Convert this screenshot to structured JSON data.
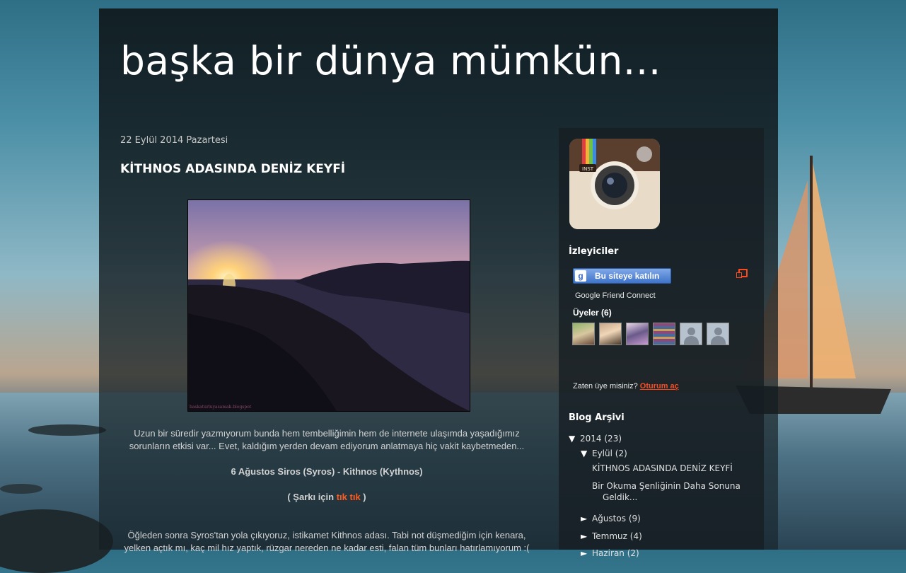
{
  "blog": {
    "title": "başka bir dünya mümkün..."
  },
  "post": {
    "date": "22 Eylül 2014 Pazartesi",
    "title": "KİTHNOS ADASINDA DENİZ KEYFİ",
    "image_watermark": "baskaturluyasamak.blogspot",
    "paragraph1": "Uzun bir süredir yazmıyorum bunda hem tembelliğimin hem de internete ulaşımda yaşadığımız sorunların etkisi var... Evet, kaldığım yerden devam ediyorum anlatmaya hiç vakit kaybetmeden...",
    "subtitle": "6 Ağustos Siros (Syros) - Kithnos (Kythnos)",
    "song_prefix": "( Şarkı için ",
    "song_link": "tık tık",
    "song_suffix": " )",
    "paragraph2": "Öğleden sonra Syros'tan yola çıkıyoruz, istikamet Kithnos adası. Tabi not düşmediğim için kenara, yelken açtık mı, kaç mil hız yaptık, rüzgar nereden ne kadar esti, falan tüm bunları hatırlamıyorum :("
  },
  "sidebar": {
    "followers_title": "İzleyiciler",
    "join_button": "Bu siteye katılın",
    "gfc_label": "Google Friend Connect",
    "members_label": "Üyeler (6)",
    "already_member": "Zaten üye misiniz?",
    "sign_in": "Oturum aç",
    "archive_title": "Blog Arşivi",
    "archive": {
      "year": {
        "toggle": "▼",
        "label": "2014",
        "count": "(23)"
      },
      "months": [
        {
          "toggle": "▼",
          "label": "Eylül",
          "count": "(2)"
        },
        {
          "toggle": "►",
          "label": "Ağustos",
          "count": "(9)"
        },
        {
          "toggle": "►",
          "label": "Temmuz",
          "count": "(4)"
        },
        {
          "toggle": "►",
          "label": "Haziran",
          "count": "(2)"
        }
      ],
      "posts": [
        "KİTHNOS ADASINDA DENİZ KEYFİ",
        "Bir Okuma Şenliğinin Daha Sonuna Geldik..."
      ]
    }
  },
  "colors": {
    "accent": "#ff5a1f",
    "text": "#d2d2d2"
  }
}
